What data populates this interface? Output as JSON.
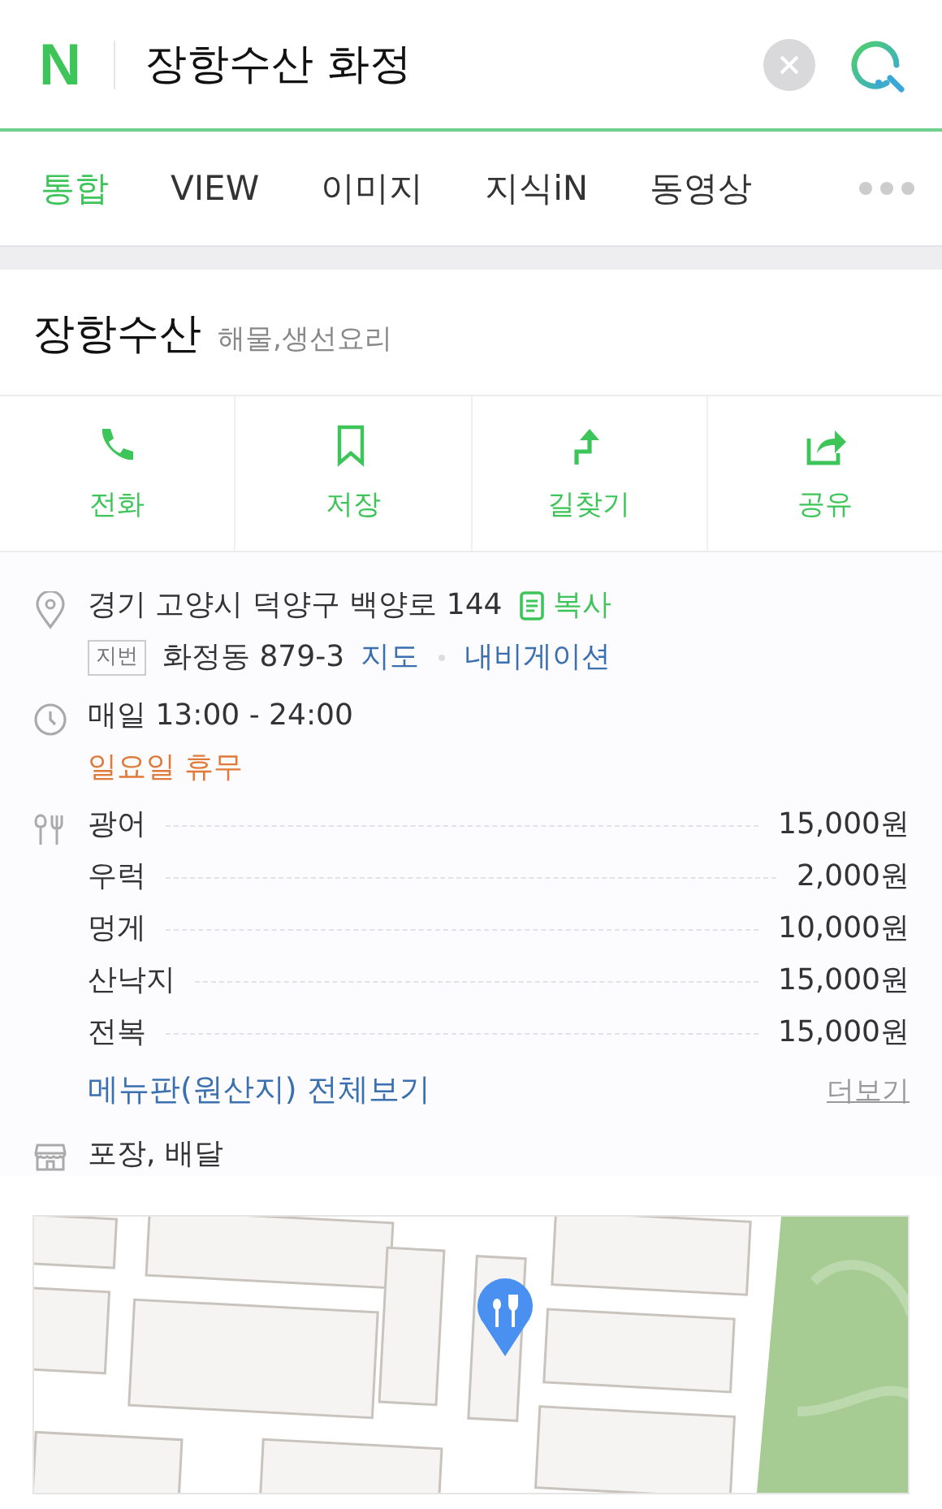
{
  "search": {
    "logo": "N",
    "value": "장항수산 화정"
  },
  "tabs": [
    {
      "label": "통합",
      "selected": true
    },
    {
      "label": "VIEW",
      "selected": false
    },
    {
      "label": "이미지",
      "selected": false
    },
    {
      "label": "지식iN",
      "selected": false
    },
    {
      "label": "동영상",
      "selected": false
    }
  ],
  "place": {
    "name": "장항수산",
    "category": "해물,생선요리"
  },
  "actions": [
    {
      "kind": "phone",
      "label": "전화"
    },
    {
      "kind": "bookmark",
      "label": "저장"
    },
    {
      "kind": "route",
      "label": "길찾기"
    },
    {
      "kind": "share",
      "label": "공유"
    }
  ],
  "address": {
    "road": "경기 고양시 덕양구 백양로 144",
    "copy": "복사",
    "lot_tag": "지번",
    "lot": "화정동 879-3",
    "map_link": "지도",
    "nav_link": "내비게이션"
  },
  "hours": {
    "time": "매일 13:00 - 24:00",
    "closed": "일요일 휴무"
  },
  "menu": [
    {
      "name": "광어",
      "price": "15,000원"
    },
    {
      "name": "우럭",
      "price": "2,000원"
    },
    {
      "name": "멍게",
      "price": "10,000원"
    },
    {
      "name": "산낙지",
      "price": "15,000원"
    },
    {
      "name": "전복",
      "price": "15,000원"
    }
  ],
  "menu_link": "메뉴판(원산지) 전체보기",
  "more": "더보기",
  "services": "포장, 배달"
}
